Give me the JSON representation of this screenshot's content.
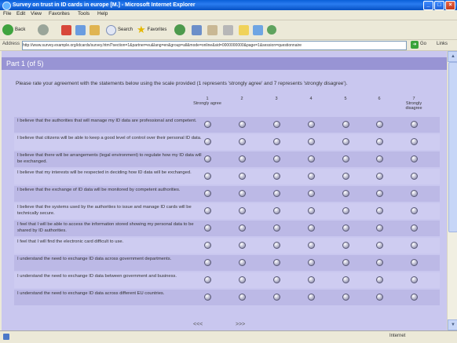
{
  "window": {
    "title": "Survey on trust in ID cards in europe [M.] - Microsoft Internet Explorer"
  },
  "menu": [
    "File",
    "Edit",
    "View",
    "Favorites",
    "Tools",
    "Help"
  ],
  "toolbar": {
    "back": "Back",
    "search": "Search",
    "favorites": "Favorites"
  },
  "address": {
    "label": "Address",
    "url": "http://www.survey.example.org/idcards/survey.html?section=1&partner=eu&lang=en&group=all&mode=online&sid=0000000000&page=1&session=questionnaire",
    "go": "Go",
    "links": "Links"
  },
  "survey": {
    "part_title": "Part 1 (of 5)",
    "instructions": "Please rate your agreement with the statements below using the scale provided (1 represents 'strongly agree' and 7 represents 'strongly disagree').",
    "scale": [
      {
        "num": "1",
        "label": "Strongly agree"
      },
      {
        "num": "2",
        "label": ""
      },
      {
        "num": "3",
        "label": ""
      },
      {
        "num": "4",
        "label": ""
      },
      {
        "num": "5",
        "label": ""
      },
      {
        "num": "6",
        "label": ""
      },
      {
        "num": "7",
        "label": "Strongly disagree"
      }
    ],
    "statements": [
      "I believe that the authorities that will manage my ID data are professional and competent.",
      "I believe that citizens will be able to keep a good level of control over their personal ID data.",
      "I believe that there will be arrangements (legal environment) to regulate how my ID data will be exchanged.",
      "I believe that my interests will be respected in deciding how ID data will be exchanged.",
      "I believe that the exchange of ID data will be monitored by competent authorities.",
      "I believe that the systems used by the authorities to issue and manage ID cards will be technically secure.",
      "I feel that I will be able to access the information stored showing my personal data to be shared by ID authorities.",
      "I feel that I will find the electronic card difficult to use.",
      "I understand the need to exchange ID data across government departments.",
      "I understand the need to exchange ID data between government and business.",
      "I understand the need to exchange ID data across different EU countries."
    ],
    "nav": {
      "prev": "<<<",
      "next": ">>>"
    }
  },
  "status": {
    "zone": "Internet"
  }
}
